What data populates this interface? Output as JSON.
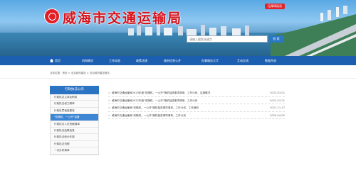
{
  "header": {
    "site_title": "威海市交通运输局",
    "top_badge": "无障碍阅读",
    "search_placeholder": "请输入搜索关键字",
    "search_button": "检 索"
  },
  "nav": {
    "items": [
      {
        "label": "首页",
        "icon": "home-icon"
      },
      {
        "label": "机构概况"
      },
      {
        "label": "工作动态"
      },
      {
        "label": "政策法规"
      },
      {
        "label": "政府信息公开"
      },
      {
        "label": "办事服务大厅"
      },
      {
        "label": "互动交流"
      },
      {
        "label": "数据开放"
      }
    ]
  },
  "breadcrumb": "当前位置：首页 > 法治政府建设 > 法治政府建设报告",
  "sidebar": {
    "heading": "行政执法公示",
    "items": [
      {
        "label": "行政执法主体及职权",
        "active": false
      },
      {
        "label": "行政执法权力清单",
        "active": false
      },
      {
        "label": "行政处罚裁量基准",
        "active": false
      },
      {
        "label": "\"双随机、一公开\"监管",
        "active": true
      },
      {
        "label": "行政执法人员资格清单",
        "active": false
      },
      {
        "label": "行政执法结果信息",
        "active": false
      },
      {
        "label": "行政执法统计年报",
        "active": false
      },
      {
        "label": "行政执法流程",
        "active": false
      },
      {
        "label": "一次办好清单",
        "active": false
      }
    ]
  },
  "news": [
    {
      "title": "威海市交通运输局2023年度\"双随机、一公开\"随机抽查事项清单、工作计划、实施情况",
      "date": "2023-03-01"
    },
    {
      "title": "威海市交通运输局2022年度\"双随机、一公开\"随机抽查事项清单、工作计划",
      "date": "2022-03-21"
    },
    {
      "title": "威海市交通运输局\"双随机、一公开\"随机抽查事项清单、工作计划、工作细则",
      "date": "2021-11-17"
    },
    {
      "title": "威海市交通运输局\"双随机、一公开\"随机抽查事项清单、工作计划",
      "date": "2020-04-02"
    }
  ],
  "colors": {
    "nav_bg": "#1c5fb0",
    "title_red": "#d8121a",
    "sidebar_head": "#2b73c3",
    "sidebar_active": "#3d86d3"
  }
}
